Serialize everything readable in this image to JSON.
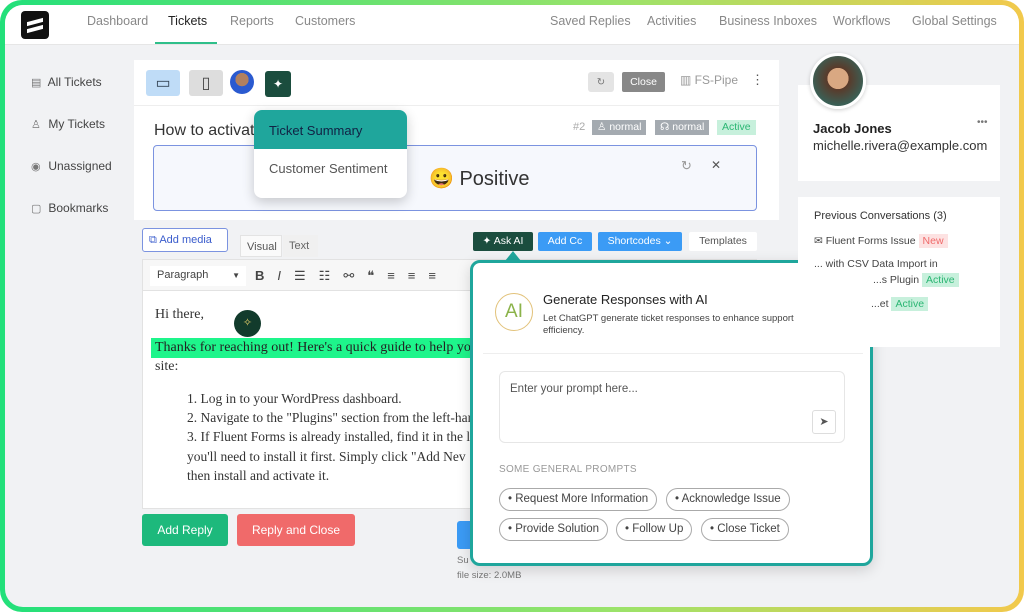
{
  "nav": {
    "left": [
      "Dashboard",
      "Tickets",
      "Reports",
      "Customers"
    ],
    "right": [
      "Saved Replies",
      "Activities",
      "Business Inboxes",
      "Workflows",
      "Global Settings"
    ],
    "active": "Tickets"
  },
  "sidebar": {
    "items": [
      {
        "label": "All Tickets",
        "icon": "document-icon"
      },
      {
        "label": "My Tickets",
        "icon": "user-icon"
      },
      {
        "label": "Unassigned",
        "icon": "eye-icon"
      },
      {
        "label": "Bookmarks",
        "icon": "bookmark-icon"
      }
    ]
  },
  "ticket": {
    "title": "How to activat",
    "number": "#2",
    "tags": [
      "normal",
      "normal"
    ],
    "status": "Active",
    "close": "Close",
    "mailbox": "FS-Pipe",
    "sentiment": "😀 Positive"
  },
  "ai_menu": {
    "items": [
      "Ticket Summary",
      "Customer Sentiment"
    ]
  },
  "editor": {
    "add_media": "Add media",
    "tabs": [
      "Visual",
      "Text"
    ],
    "ask_ai": "Ask AI",
    "add_cc": "Add Cc",
    "shortcodes": "Shortcodes",
    "templates": "Templates",
    "format": "Paragraph",
    "greeting": "Hi there,",
    "highlight": "Thanks for reaching out! Here's a quick guide to help yo",
    "site": "site:",
    "list": [
      "1. Log in to your WordPress dashboard.",
      "2. Navigate to the \"Plugins\" section from the left-har",
      "3. If Fluent Forms is already installed, find it in the l",
      "you'll need to install it first. Simply click \"Add Nev",
      "then install and activate it."
    ]
  },
  "actions": {
    "add_reply": "Add Reply",
    "reply_close": "Reply and Close",
    "upload_hint": "Su",
    "file_size": "file size: 2.0MB"
  },
  "ai_panel": {
    "badge": "AI",
    "title": "Generate Responses with AI",
    "subtitle": "Let ChatGPT generate ticket responses to enhance support efficiency.",
    "placeholder": "Enter your prompt here...",
    "prompts_heading": "SOME GENERAL PROMPTS",
    "prompts": [
      "Request More Information",
      "Acknowledge Issue",
      "Provide Solution",
      "Follow Up",
      "Close Ticket"
    ]
  },
  "customer": {
    "name": "Jacob Jones",
    "email": "michelle.rivera@example.com"
  },
  "previous": {
    "heading": "Previous Conversations (3)",
    "items": [
      {
        "title": "Fluent Forms Issue",
        "status": "New"
      },
      {
        "title": "... with CSV Data Import in",
        "title2": "...s Plugin",
        "status": "Active"
      },
      {
        "title": "...et",
        "status": "Active"
      }
    ]
  },
  "colors": {
    "accent": "#1fa69c",
    "green": "#1db97c",
    "red": "#f06a6a",
    "blue": "#3b9bf5",
    "dark": "#1b4d3e"
  }
}
